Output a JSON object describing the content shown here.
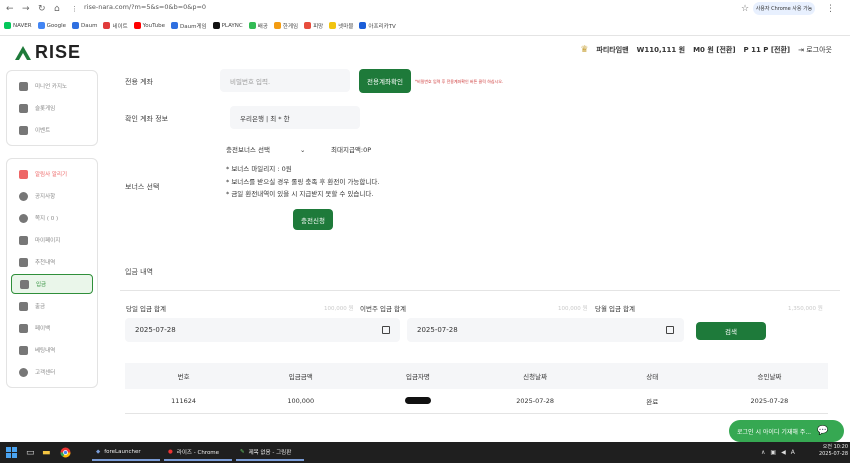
{
  "browser": {
    "url": "rise-nara.com/?m=5&s=0&b=0&p=0",
    "profile_label": "사용자 Chrome 사용 가능",
    "bookmarks": [
      "NAVER",
      "Google",
      "Daum",
      "네이트",
      "YouTube",
      "Daum게임",
      "PLAYNC",
      "배공",
      "한게임",
      "피망",
      "넷마블",
      "아프리카TV"
    ]
  },
  "header": {
    "logo_text": "RISE",
    "username": "파티타임맨",
    "balance": "W110,111 원",
    "zero_items": "M0 원 [전환]",
    "points": "P 11 P [전환]",
    "logout": "로그아웃"
  },
  "sidebar": {
    "group1": [
      {
        "label": "미니언 카지노",
        "icon": "ticket-icon"
      },
      {
        "label": "슬롯게임",
        "icon": "slot-icon"
      },
      {
        "label": "이벤트",
        "icon": "event-icon"
      }
    ],
    "group2": [
      {
        "label": "알림사 알리기",
        "icon": "alert-icon"
      },
      {
        "label": "공지사항",
        "icon": "info-icon"
      },
      {
        "label": "쪽지 ( 0 )",
        "icon": "message-icon"
      },
      {
        "label": "마이페이지",
        "icon": "user-icon"
      },
      {
        "label": "추천내역",
        "icon": "share-icon"
      },
      {
        "label": "입금",
        "icon": "deposit-icon",
        "active": true
      },
      {
        "label": "출금",
        "icon": "withdraw-icon"
      },
      {
        "label": "페이백",
        "icon": "payback-icon"
      },
      {
        "label": "베팅내역",
        "icon": "bet-history-icon"
      },
      {
        "label": "고객센터",
        "icon": "support-icon"
      }
    ]
  },
  "form": {
    "account_label": "전용 계좌",
    "password_placeholder": "비밀번호 입력.",
    "confirm_button": "전용계좌확인",
    "confirm_note": "*비밀번호 입력 후 전용계좌확인 버튼 클릭 하십시오.",
    "verify_label": "확인 계좌 정보",
    "bank_value": "우리은행 | 최 * 한",
    "bonus_label": "보너스 선택",
    "bonus_select": "충전보너스 선택",
    "max_payout": "최대지급액:0P",
    "notes": [
      "* 보너스 마일리지 : 0원",
      "* 보너스를 받으실 경우 롤링 충족 후 환전이 가능합니다.",
      "* 금일 환전내역이 있을 시 지급받지 못할 수 있습니다."
    ],
    "submit_button": "충전신청"
  },
  "history": {
    "title": "입금 내역",
    "today_label": "당일 입금 합계",
    "today_value": "100,000 원",
    "week_label": "이번주 입금 합계",
    "week_value": "100,000 원",
    "month_label": "당월 입금 합계",
    "month_value": "1,350,000 원",
    "start_date": "2025-07-28",
    "end_date": "2025-07-28",
    "search_button": "검색",
    "columns": [
      "번호",
      "입금금액",
      "입금자명",
      "신청날짜",
      "상태",
      "승인날짜"
    ],
    "rows": [
      {
        "no": "111624",
        "amount": "100,000",
        "date": "2025-07-28",
        "status": "완료",
        "approved": "2025-07-28"
      }
    ]
  },
  "chat_widget": {
    "label": "로그인 시 아이디 기재해 주..."
  },
  "taskbar": {
    "apps": [
      "foreLauncher",
      "라이즈 - Chrome",
      "제목 없음 - 그림판"
    ],
    "time": "오전 10:20",
    "date": "2025-07-28"
  },
  "colors": {
    "brand": "#1e7a3a",
    "active": "#2f8f3a",
    "taskbar": "#1f1f1f"
  }
}
